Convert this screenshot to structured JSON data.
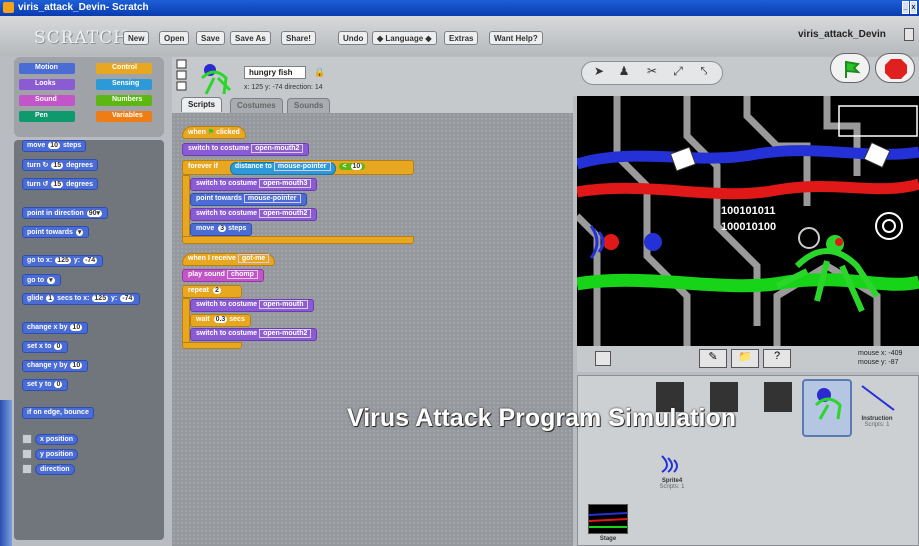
{
  "window": {
    "title": "viris_attack_Devin- Scratch"
  },
  "toolbar": {
    "logo": "SCRATCH",
    "buttons": [
      "New",
      "Open",
      "Save",
      "Save As",
      "Share!",
      "Undo",
      "◆ Language ◆",
      "Extras",
      "Want Help?"
    ],
    "project_name": "viris_attack_Devin"
  },
  "categories": [
    {
      "label": "Motion",
      "color": "#4a6cd4"
    },
    {
      "label": "Control",
      "color": "#e8a721"
    },
    {
      "label": "Looks",
      "color": "#8b5bd4"
    },
    {
      "label": "Sensing",
      "color": "#2d9ad8"
    },
    {
      "label": "Sound",
      "color": "#c255c8"
    },
    {
      "label": "Numbers",
      "color": "#5cb712"
    },
    {
      "label": "Pen",
      "color": "#0e9a6c"
    },
    {
      "label": "Variables",
      "color": "#ee7d16"
    }
  ],
  "palette": {
    "move": {
      "a": "move",
      "v": "10",
      "b": "steps"
    },
    "turn_cw": {
      "a": "turn ↻",
      "v": "15",
      "b": "degrees"
    },
    "turn_ccw": {
      "a": "turn ↺",
      "v": "15",
      "b": "degrees"
    },
    "point_dir": {
      "a": "point in direction",
      "v": "90▾"
    },
    "point_towards": {
      "a": "point towards",
      "v": "▾"
    },
    "goto_xy": {
      "a": "go to x:",
      "v1": "125",
      "b": "y:",
      "v2": "-74"
    },
    "goto": {
      "a": "go to",
      "v": "▾"
    },
    "glide": {
      "a": "glide",
      "v1": "1",
      "b": "secs to x:",
      "v2": "125",
      "c": "y:",
      "v3": "-74"
    },
    "change_x": {
      "a": "change x by",
      "v": "10"
    },
    "set_x": {
      "a": "set x to",
      "v": "0"
    },
    "change_y": {
      "a": "change y by",
      "v": "10"
    },
    "set_y": {
      "a": "set y to",
      "v": "0"
    },
    "bounce": "if on edge, bounce",
    "reporters": [
      "x position",
      "y position",
      "direction"
    ]
  },
  "sprite": {
    "name": "hungry fish",
    "x_label": "x:",
    "x": "125",
    "y_label": "y:",
    "y": "-74",
    "dir_label": "direction:",
    "dir": "14"
  },
  "tabs": [
    "Scripts",
    "Costumes",
    "Sounds"
  ],
  "script1": {
    "hat_a": "when",
    "hat_b": "clicked",
    "costume1": {
      "a": "switch to costume",
      "v": "open-mouth2"
    },
    "forever_if": "forever if",
    "distance": {
      "a": "distance to",
      "v": "mouse-pointer"
    },
    "lt": "<",
    "lt_v": "10",
    "costume2": {
      "a": "switch to costume",
      "v": "open-mouth3"
    },
    "towards": {
      "a": "point towards",
      "v": "mouse-pointer"
    },
    "costume3": {
      "a": "switch to costume",
      "v": "open-mouth2"
    },
    "move": {
      "a": "move",
      "v": "3",
      "b": "steps"
    }
  },
  "script2": {
    "hat": {
      "a": "when I receive",
      "v": "got-me"
    },
    "sound": {
      "a": "play sound",
      "v": "chomp"
    },
    "repeat": {
      "a": "repeat",
      "v": "2"
    },
    "costume1": {
      "a": "switch to costume",
      "v": "open-mouth"
    },
    "wait": {
      "a": "wait",
      "v": "0.3",
      "b": "secs"
    },
    "costume2": {
      "a": "switch to costume",
      "v": "open-mouth2"
    }
  },
  "stage": {
    "binary1": "100101011",
    "binary2": "100010100"
  },
  "mouse": {
    "x_label": "mouse x:",
    "x": "-409",
    "y_label": "mouse y:",
    "y": "-87"
  },
  "sprites": [
    {
      "name": "Instruction",
      "sub": "Scripts: 1"
    },
    {
      "name": "Sprite4",
      "sub": "Scripts: 1"
    },
    {
      "name": "Stage",
      "sub": ""
    }
  ],
  "overlay": {
    "title": "Virus Attack Program Simulation"
  }
}
